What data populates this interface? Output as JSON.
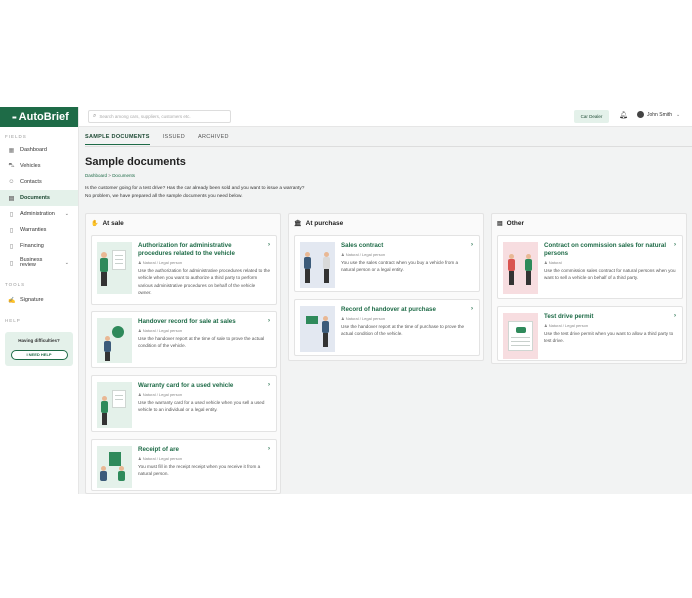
{
  "app": {
    "name": "AutoBrief"
  },
  "sidebar": {
    "section_fields": "FIELDS",
    "items": [
      {
        "label": "Dashboard"
      },
      {
        "label": "Vehicles"
      },
      {
        "label": "Contacts"
      },
      {
        "label": "Documents"
      },
      {
        "label": "Administration"
      },
      {
        "label": "Warranties"
      },
      {
        "label": "Financing"
      },
      {
        "label": "Business review"
      }
    ],
    "section_tools": "TOOLS",
    "tools": [
      {
        "label": "Signature"
      }
    ],
    "section_help": "HELP",
    "help": {
      "title": "Having difficulties?",
      "button": "I NEED HELP"
    }
  },
  "topbar": {
    "search_placeholder": "Search among cars, suppliers, customers etc.",
    "role": "Car Dealer",
    "user": "John Smith"
  },
  "tabs": [
    {
      "label": "SAMPLE DOCUMENTS"
    },
    {
      "label": "ISSUED"
    },
    {
      "label": "ARCHIVED"
    }
  ],
  "page": {
    "title": "Sample documents",
    "breadcrumb": {
      "root": "Dashboard",
      "sep": ">",
      "current": "Documents"
    },
    "intro_line1": "Is the customer going for a test drive? Has the car already been sold and you want to issue a warranty?",
    "intro_line2": "No problem, we have prepared all the sample documents you need below."
  },
  "columns": [
    {
      "title": "At sale",
      "cards": [
        {
          "title": "Authorization for administrative procedures related to the vehicle",
          "meta": "Natural / Legal person",
          "desc": "Use the authorization for administrative procedures related to the vehicle when you want to authorize a third party to perform various administrative procedures on behalf of the vehicle owner."
        },
        {
          "title": "Handover record for sale at sales",
          "meta": "Natural / Legal person",
          "desc": "Use the handover report at the time of sale to prove the actual condition of the vehicle."
        },
        {
          "title": "Warranty card for a used vehicle",
          "meta": "Natural / Legal person",
          "desc": "Use the warranty card for a used vehicle when you sell a used vehicle to an individual or a legal entity."
        },
        {
          "title": "Receipt of are",
          "meta": "Natural / Legal person",
          "desc": "You must fill in the receipt receipt when you receive it from a natural person."
        }
      ]
    },
    {
      "title": "At purchase",
      "cards": [
        {
          "title": "Sales contract",
          "meta": "Natural / Legal person",
          "desc": "You use the sales contract when you buy a vehicle from a natural person or a legal entity."
        },
        {
          "title": "Record of handover at purchase",
          "meta": "Natural / Legal person",
          "desc": "Use the handover report at the time of purchase to prove the actual condition of the vehicle."
        }
      ]
    },
    {
      "title": "Other",
      "cards": [
        {
          "title": "Contract on commission sales for natural persons",
          "meta": "Natural",
          "desc": "Use the commission sales contract for natural persons when you want to sell a vehicle on behalf of a third party."
        },
        {
          "title": "Test drive permit",
          "meta": "Natural / Legal person",
          "desc": "Use the test drive permit when you want to allow a third party to test drive."
        }
      ]
    }
  ],
  "icons": {
    "dashboard": "grid-icon",
    "vehicles": "car-icon",
    "contacts": "people-icon",
    "documents": "document-icon",
    "administration": "file-icon",
    "warranties": "file-icon",
    "financing": "file-icon",
    "business": "file-icon",
    "signature": "signature-icon",
    "search": "search-icon",
    "bell": "bell-icon",
    "user": "user-avatar-icon"
  },
  "colors": {
    "brand": "#1e6b47",
    "accent_light": "#e4f1ea"
  }
}
